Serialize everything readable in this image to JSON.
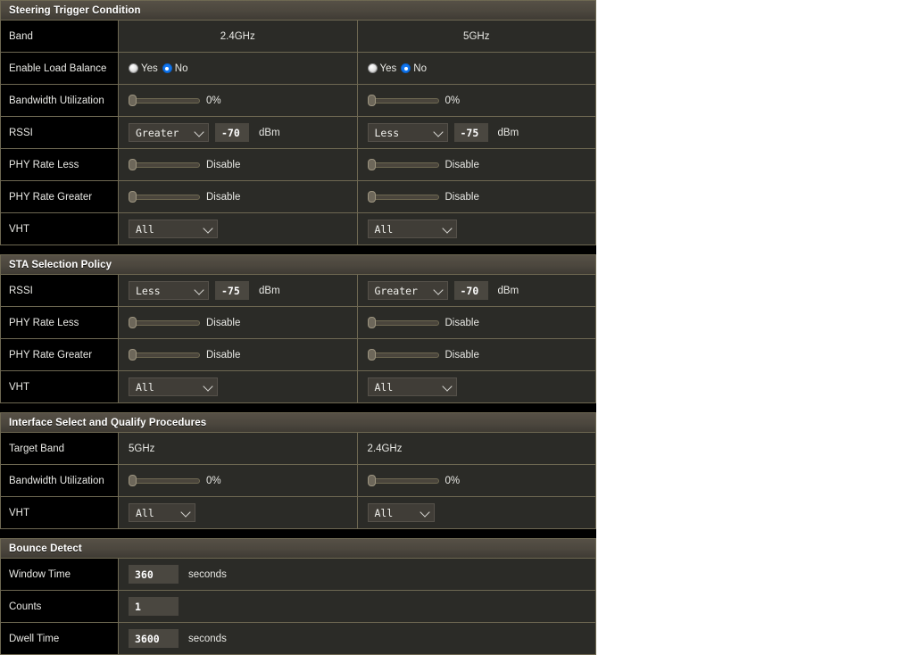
{
  "sections": [
    {
      "id": "steering-trigger-condition",
      "title": "Steering Trigger Condition",
      "rows": [
        {
          "id": "band",
          "label": "Band",
          "type": "text-center",
          "col1": {
            "text": "2.4GHz"
          },
          "col2": {
            "text": "5GHz"
          }
        },
        {
          "id": "enable-load-balance",
          "label": "Enable Load Balance",
          "type": "radio",
          "col1": {
            "options": [
              "Yes",
              "No"
            ],
            "selected": "No"
          },
          "col2": {
            "options": [
              "Yes",
              "No"
            ],
            "selected": "No"
          }
        },
        {
          "id": "bandwidth-utilization",
          "label": "Bandwidth Utilization",
          "type": "slider",
          "col1": {
            "value": 0,
            "value_label": "0%"
          },
          "col2": {
            "value": 0,
            "value_label": "0%"
          }
        },
        {
          "id": "rssi",
          "label": "RSSI",
          "type": "select-input",
          "col1": {
            "select": "Greater",
            "input": "-70",
            "unit": "dBm"
          },
          "col2": {
            "select": "Less",
            "input": "-75",
            "unit": "dBm"
          }
        },
        {
          "id": "phy-rate-less",
          "label": "PHY Rate Less",
          "type": "slider",
          "col1": {
            "value": 0,
            "value_label": "Disable"
          },
          "col2": {
            "value": 0,
            "value_label": "Disable"
          }
        },
        {
          "id": "phy-rate-greater",
          "label": "PHY Rate Greater",
          "type": "slider",
          "col1": {
            "value": 0,
            "value_label": "Disable"
          },
          "col2": {
            "value": 0,
            "value_label": "Disable"
          }
        },
        {
          "id": "vht",
          "label": "VHT",
          "type": "select",
          "col1": {
            "select": "All",
            "width": "w100"
          },
          "col2": {
            "select": "All",
            "width": "w100"
          }
        }
      ]
    },
    {
      "id": "sta-selection-policy",
      "title": "STA Selection Policy",
      "rows": [
        {
          "id": "rssi",
          "label": "RSSI",
          "type": "select-input",
          "col1": {
            "select": "Less",
            "input": "-75",
            "unit": "dBm"
          },
          "col2": {
            "select": "Greater",
            "input": "-70",
            "unit": "dBm"
          }
        },
        {
          "id": "phy-rate-less",
          "label": "PHY Rate Less",
          "type": "slider",
          "col1": {
            "value": 0,
            "value_label": "Disable"
          },
          "col2": {
            "value": 0,
            "value_label": "Disable"
          }
        },
        {
          "id": "phy-rate-greater",
          "label": "PHY Rate Greater",
          "type": "slider",
          "col1": {
            "value": 0,
            "value_label": "Disable"
          },
          "col2": {
            "value": 0,
            "value_label": "Disable"
          }
        },
        {
          "id": "vht",
          "label": "VHT",
          "type": "select",
          "col1": {
            "select": "All",
            "width": "w100"
          },
          "col2": {
            "select": "All",
            "width": "w100"
          }
        }
      ]
    },
    {
      "id": "interface-select-and-qualify-procedures",
      "title": "Interface Select and Qualify Procedures",
      "rows": [
        {
          "id": "target-band",
          "label": "Target Band",
          "type": "text",
          "col1": {
            "text": "5GHz"
          },
          "col2": {
            "text": "2.4GHz"
          }
        },
        {
          "id": "bandwidth-utilization",
          "label": "Bandwidth Utilization",
          "type": "slider",
          "col1": {
            "value": 0,
            "value_label": "0%"
          },
          "col2": {
            "value": 0,
            "value_label": "0%"
          }
        },
        {
          "id": "vht",
          "label": "VHT",
          "type": "select",
          "col1": {
            "select": "All",
            "width": "w75"
          },
          "col2": {
            "select": "All",
            "width": "w75"
          }
        }
      ]
    },
    {
      "id": "bounce-detect",
      "title": "Bounce Detect",
      "single_column": true,
      "rows": [
        {
          "id": "window-time",
          "label": "Window Time",
          "type": "input",
          "col1": {
            "input": "360",
            "unit": "seconds",
            "width": "w56"
          }
        },
        {
          "id": "counts",
          "label": "Counts",
          "type": "input",
          "col1": {
            "input": "1",
            "unit": "",
            "width": "w56"
          }
        },
        {
          "id": "dwell-time",
          "label": "Dwell Time",
          "type": "input",
          "col1": {
            "input": "3600",
            "unit": "seconds",
            "width": "w56"
          }
        }
      ]
    }
  ],
  "icons": {
    "caret": "chevron-down-icon"
  },
  "colors": {
    "accent": "#1176f1",
    "panel_bg": "#2b2b27",
    "label_bg": "#000000",
    "border": "#6e6852",
    "header_bg": "#4c473e"
  }
}
